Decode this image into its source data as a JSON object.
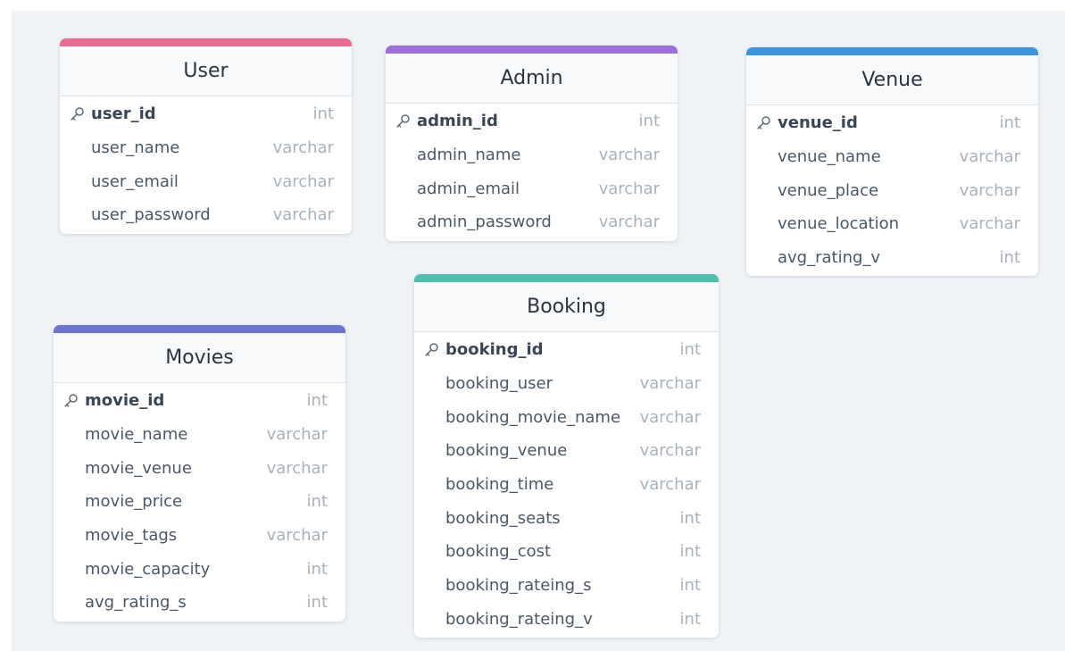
{
  "tables": [
    {
      "id": "t-user",
      "name": "User",
      "color": "#ec6b93",
      "fields": [
        {
          "name": "user_id",
          "type": "int",
          "pk": true
        },
        {
          "name": "user_name",
          "type": "varchar",
          "pk": false
        },
        {
          "name": "user_email",
          "type": "varchar",
          "pk": false
        },
        {
          "name": "user_password",
          "type": "varchar",
          "pk": false
        }
      ]
    },
    {
      "id": "t-admin",
      "name": "Admin",
      "color": "#9b6fdc",
      "fields": [
        {
          "name": "admin_id",
          "type": "int",
          "pk": true
        },
        {
          "name": "admin_name",
          "type": "varchar",
          "pk": false
        },
        {
          "name": "admin_email",
          "type": "varchar",
          "pk": false
        },
        {
          "name": "admin_password",
          "type": "varchar",
          "pk": false
        }
      ]
    },
    {
      "id": "t-venue",
      "name": "Venue",
      "color": "#3e94dc",
      "fields": [
        {
          "name": "venue_id",
          "type": "int",
          "pk": true
        },
        {
          "name": "venue_name",
          "type": "varchar",
          "pk": false
        },
        {
          "name": "venue_place",
          "type": "varchar",
          "pk": false
        },
        {
          "name": "venue_location",
          "type": "varchar",
          "pk": false
        },
        {
          "name": "avg_rating_v",
          "type": "int",
          "pk": false
        }
      ]
    },
    {
      "id": "t-booking",
      "name": "Booking",
      "color": "#4fbfae",
      "fields": [
        {
          "name": "booking_id",
          "type": "int",
          "pk": true
        },
        {
          "name": "booking_user",
          "type": "varchar",
          "pk": false
        },
        {
          "name": "booking_movie_name",
          "type": "varchar",
          "pk": false
        },
        {
          "name": "booking_venue",
          "type": "varchar",
          "pk": false
        },
        {
          "name": "booking_time",
          "type": "varchar",
          "pk": false
        },
        {
          "name": "booking_seats",
          "type": "int",
          "pk": false
        },
        {
          "name": "booking_cost",
          "type": "int",
          "pk": false
        },
        {
          "name": "booking_rateing_s",
          "type": "int",
          "pk": false
        },
        {
          "name": "booking_rateing_v",
          "type": "int",
          "pk": false
        }
      ]
    },
    {
      "id": "t-movies",
      "name": "Movies",
      "color": "#6c75cf",
      "fields": [
        {
          "name": "movie_id",
          "type": "int",
          "pk": true
        },
        {
          "name": "movie_name",
          "type": "varchar",
          "pk": false
        },
        {
          "name": "movie_venue",
          "type": "varchar",
          "pk": false
        },
        {
          "name": "movie_price",
          "type": "int",
          "pk": false
        },
        {
          "name": "movie_tags",
          "type": "varchar",
          "pk": false
        },
        {
          "name": "movie_capacity",
          "type": "int",
          "pk": false
        },
        {
          "name": "avg_rating_s",
          "type": "int",
          "pk": false
        }
      ]
    }
  ],
  "icons": {
    "primary_key": "key-icon"
  }
}
